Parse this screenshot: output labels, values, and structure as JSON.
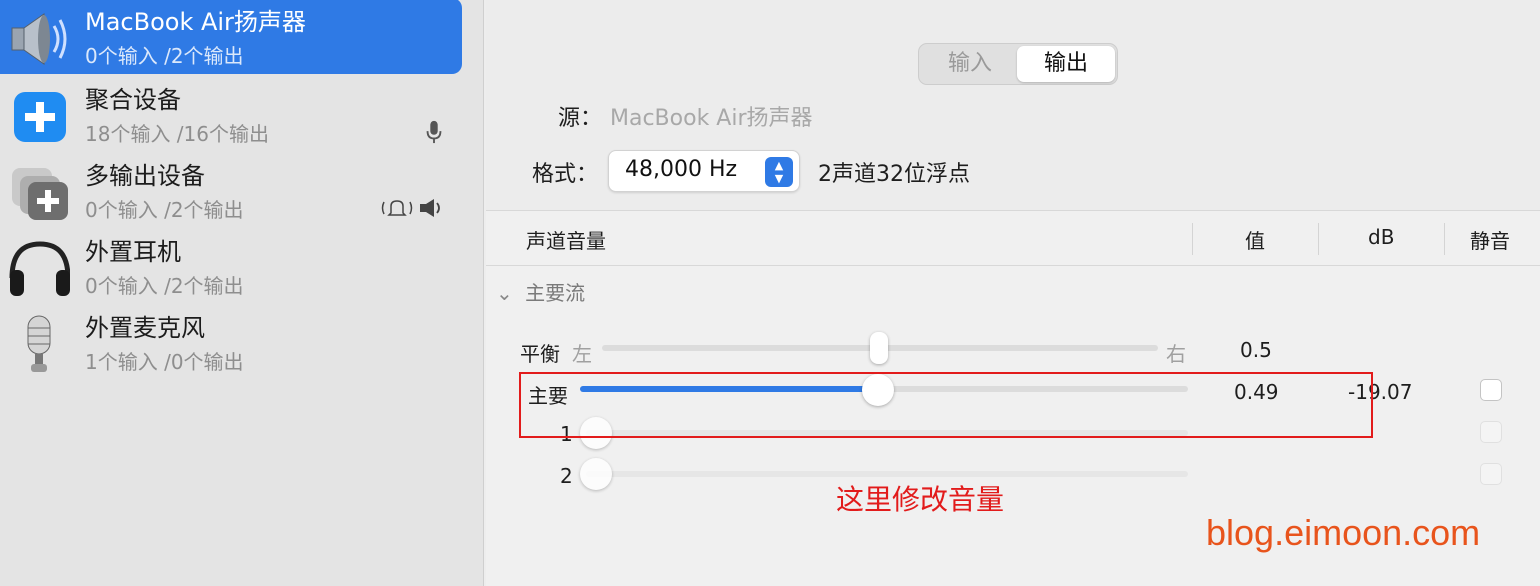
{
  "devices": [
    {
      "name": "MacBook Air扬声器",
      "sub": "0个输入 /2个输出",
      "icon": "speaker-icon",
      "selected": true
    },
    {
      "name": "聚合设备",
      "sub": "18个输入 /16个输出",
      "icon": "plus-icon",
      "badge": "microphone-icon"
    },
    {
      "name": "多输出设备",
      "sub": "0个输入 /2个输出",
      "icon": "multi-output-icon",
      "badge": "alert-bell-speaker-icon"
    },
    {
      "name": "外置耳机",
      "sub": "0个输入 /2个输出",
      "icon": "headphones-icon"
    },
    {
      "name": "外置麦克风",
      "sub": "1个输入 /0个输出",
      "icon": "microphone-icon"
    }
  ],
  "segment": {
    "input": "输入",
    "output": "输出",
    "active": "output"
  },
  "source": {
    "label": "源：",
    "value": "MacBook Air扬声器"
  },
  "format": {
    "label": "格式：",
    "rate": "48,000 Hz",
    "extra": "2声道32位浮点"
  },
  "table": {
    "headers": {
      "channel_volume": "声道音量",
      "value": "值",
      "db": "dB",
      "mute": "静音"
    },
    "group": "主要流",
    "balance": {
      "label": "平衡",
      "left": "左",
      "right": "右",
      "value": "0.5",
      "level": 0.5
    },
    "rows": [
      {
        "label": "主要",
        "value": "0.49",
        "db": "-19.07",
        "level": 0.49,
        "muted": false
      },
      {
        "label": "1",
        "value": "",
        "db": "",
        "level": 0.0,
        "muted": false
      },
      {
        "label": "2",
        "value": "",
        "db": "",
        "level": 0.0,
        "muted": false
      }
    ]
  },
  "annotation": "这里修改音量",
  "watermark": "blog.eimoon.com",
  "colors": {
    "accent": "#2f7ae5",
    "annotation": "#e21b1b",
    "watermark": "#e8541c"
  }
}
